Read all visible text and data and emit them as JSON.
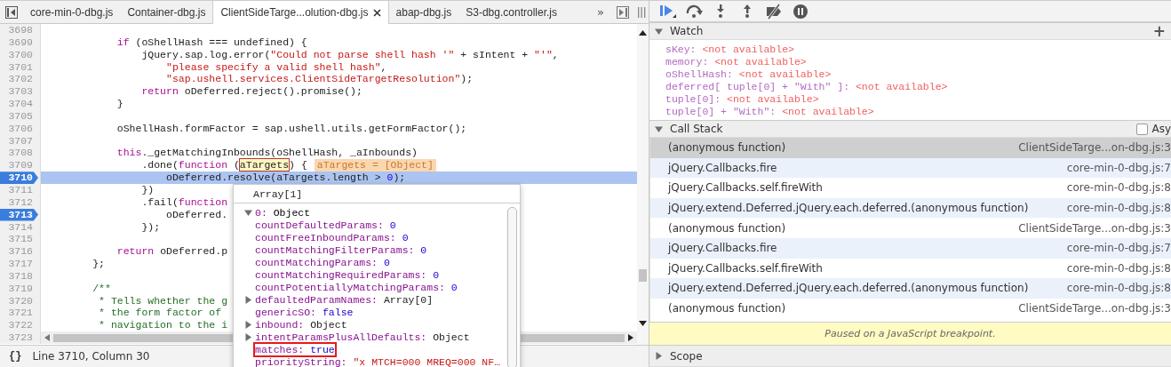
{
  "editor": {
    "tabs": [
      {
        "label": "core-min-0-dbg.js",
        "selected": false
      },
      {
        "label": "Container-dbg.js",
        "selected": false
      },
      {
        "label": "ClientSideTarge...olution-dbg.js",
        "selected": true
      },
      {
        "label": "abap-dbg.js",
        "selected": false
      },
      {
        "label": "S3-dbg.controller.js",
        "selected": false
      }
    ],
    "overflow": "»",
    "lines": [
      {
        "number": "3698",
        "breakpoint": false,
        "current": false
      },
      {
        "number": "3699",
        "breakpoint": false,
        "current": false,
        "tokens": [
          {
            "kind": "keyword",
            "text": "            if"
          },
          {
            "kind": "plain",
            "text": " (oShellHash === undefined) {"
          }
        ]
      },
      {
        "number": "3700",
        "breakpoint": false,
        "current": false,
        "tokens": [
          {
            "kind": "plain",
            "text": "                jQuery.sap.log.error("
          },
          {
            "kind": "string",
            "text": "\"Could not parse shell hash '\""
          },
          {
            "kind": "plain",
            "text": " + sIntent + "
          },
          {
            "kind": "string",
            "text": "\"'\""
          },
          {
            "kind": "plain",
            "text": ","
          }
        ]
      },
      {
        "number": "3701",
        "breakpoint": false,
        "current": false,
        "tokens": [
          {
            "kind": "string",
            "text": "                    \"please specify a valid shell hash\""
          },
          {
            "kind": "plain",
            "text": ","
          }
        ]
      },
      {
        "number": "3702",
        "breakpoint": false,
        "current": false,
        "tokens": [
          {
            "kind": "string",
            "text": "                    \"sap.ushell.services.ClientSideTargetResolution\""
          },
          {
            "kind": "plain",
            "text": ");"
          }
        ]
      },
      {
        "number": "3703",
        "breakpoint": false,
        "current": false,
        "tokens": [
          {
            "kind": "keyword",
            "text": "                return"
          },
          {
            "kind": "plain",
            "text": " oDeferred.reject().promise();"
          }
        ]
      },
      {
        "number": "3704",
        "breakpoint": false,
        "current": false,
        "tokens": [
          {
            "kind": "plain",
            "text": "            }"
          }
        ]
      },
      {
        "number": "3705",
        "breakpoint": false,
        "current": false
      },
      {
        "number": "3706",
        "breakpoint": false,
        "current": false,
        "tokens": [
          {
            "kind": "plain",
            "text": "            oShellHash.formFactor = sap.ushell.utils.getFormFactor();"
          }
        ]
      },
      {
        "number": "3707",
        "breakpoint": false,
        "current": false
      },
      {
        "number": "3708",
        "breakpoint": false,
        "current": false,
        "tokens": [
          {
            "kind": "keyword",
            "text": "            this"
          },
          {
            "kind": "plain",
            "text": "._getMatchingInbounds(oShellHash, _aInbounds)"
          }
        ]
      },
      {
        "number": "3709",
        "breakpoint": false,
        "current": false,
        "tokens": [
          {
            "kind": "plain",
            "text": "                .done("
          },
          {
            "kind": "keyword",
            "text": "function"
          },
          {
            "kind": "plain",
            "text": " ("
          },
          {
            "kind": "hover",
            "text": "aTargets"
          },
          {
            "kind": "plain",
            "text": ") {"
          }
        ],
        "inline_value": "aTargets = [Object]"
      },
      {
        "number": "3710",
        "breakpoint": true,
        "current": true,
        "tokens": [
          {
            "kind": "plain",
            "text": "                    oDeferred.resolve(aTargets.length > "
          },
          {
            "kind": "number",
            "text": "0"
          },
          {
            "kind": "plain",
            "text": ");"
          }
        ]
      },
      {
        "number": "3711",
        "breakpoint": false,
        "current": false,
        "tokens": [
          {
            "kind": "plain",
            "text": "                })"
          }
        ]
      },
      {
        "number": "3712",
        "breakpoint": false,
        "current": false,
        "tokens": [
          {
            "kind": "plain",
            "text": "                .fail("
          },
          {
            "kind": "keyword",
            "text": "function"
          }
        ]
      },
      {
        "number": "3713",
        "breakpoint": true,
        "current": false,
        "tokens": [
          {
            "kind": "plain",
            "text": "                    oDeferred."
          }
        ]
      },
      {
        "number": "3714",
        "breakpoint": false,
        "current": false,
        "tokens": [
          {
            "kind": "plain",
            "text": "                });"
          }
        ]
      },
      {
        "number": "3715",
        "breakpoint": false,
        "current": false
      },
      {
        "number": "3716",
        "breakpoint": false,
        "current": false,
        "tokens": [
          {
            "kind": "keyword",
            "text": "            return"
          },
          {
            "kind": "plain",
            "text": " oDeferred.p"
          }
        ]
      },
      {
        "number": "3717",
        "breakpoint": false,
        "current": false,
        "tokens": [
          {
            "kind": "plain",
            "text": "        };"
          }
        ]
      },
      {
        "number": "3718",
        "breakpoint": false,
        "current": false
      },
      {
        "number": "3719",
        "breakpoint": false,
        "current": false,
        "tokens": [
          {
            "kind": "comment",
            "text": "        /**"
          }
        ]
      },
      {
        "number": "3720",
        "breakpoint": false,
        "current": false,
        "tokens": [
          {
            "kind": "comment",
            "text": "         * Tells whether the g"
          }
        ]
      },
      {
        "number": "3721",
        "breakpoint": false,
        "current": false,
        "tokens": [
          {
            "kind": "comment",
            "text": "         * the form factor of"
          }
        ]
      },
      {
        "number": "3722",
        "breakpoint": false,
        "current": false,
        "tokens": [
          {
            "kind": "comment",
            "text": "         * navigation to the i"
          }
        ]
      },
      {
        "number": "3723",
        "breakpoint": false,
        "current": false
      }
    ],
    "popover": {
      "title": "Array[1]",
      "root": {
        "name": "0:",
        "value": "Object",
        "expanded": true,
        "children": [
          {
            "name": "countDefaultedParams:",
            "value": "0",
            "kind": "number",
            "highlighted": false
          },
          {
            "name": "countFreeInboundParams:",
            "value": "0",
            "kind": "number",
            "highlighted": false
          },
          {
            "name": "countMatchingFilterParams:",
            "value": "0",
            "kind": "number",
            "highlighted": false
          },
          {
            "name": "countMatchingParams:",
            "value": "0",
            "kind": "number",
            "highlighted": false
          },
          {
            "name": "countMatchingRequiredParams:",
            "value": "0",
            "kind": "number",
            "highlighted": false
          },
          {
            "name": "countPotentiallyMatchingParams:",
            "value": "0",
            "kind": "number",
            "highlighted": false
          },
          {
            "name": "defaultedParamNames:",
            "value": "Array[0]",
            "kind": "object",
            "expanded": false,
            "highlighted": false
          },
          {
            "name": "genericSO:",
            "value": "false",
            "kind": "boolean",
            "highlighted": false
          },
          {
            "name": "inbound:",
            "value": "Object",
            "kind": "object",
            "expanded": false,
            "highlighted": false
          },
          {
            "name": "intentParamsPlusAllDefaults:",
            "value": "Object",
            "kind": "object",
            "expanded": false,
            "highlighted": false
          },
          {
            "name": "matches:",
            "value": "true",
            "kind": "boolean",
            "highlighted": true
          },
          {
            "name": "priorityString:",
            "value": "\"x MTCH=000 MREQ=000 NF…",
            "kind": "string",
            "highlighted": false
          }
        ]
      }
    },
    "status": {
      "format_button": "{}",
      "position": "Line 3710, Column 30"
    }
  },
  "debugger": {
    "toolbar": [
      {
        "kind": "resume"
      },
      {
        "kind": "step_over"
      },
      {
        "kind": "step_into"
      },
      {
        "kind": "step_out"
      },
      {
        "kind": "deactivate"
      },
      {
        "kind": "pause"
      }
    ],
    "watch": {
      "title": "Watch",
      "expanded": true,
      "add": "+",
      "items": [
        {
          "expression": "sKey:",
          "value": "<not available>"
        },
        {
          "expression": "memory:",
          "value": "<not available>"
        },
        {
          "expression": "oShellHash:",
          "value": "<not available>"
        },
        {
          "expression": "deferred[ tuple[0] + \"With\" ]:",
          "value": "<not available>"
        },
        {
          "expression": "tuple[0]:",
          "value": "<not available>"
        },
        {
          "expression": "tuple[0] + \"With\":",
          "value": "<not available>"
        }
      ]
    },
    "call_stack": {
      "title": "Call Stack",
      "expanded": true,
      "async": {
        "label": "Asy",
        "checked": false
      },
      "frames": [
        {
          "name": "(anonymous function)",
          "location": "ClientSideTarge...on-dbg.js:3",
          "selected": true
        },
        {
          "name": "jQuery.Callbacks.fire",
          "location": "core-min-0-dbg.js:7",
          "selected": false
        },
        {
          "name": "jQuery.Callbacks.self.fireWith",
          "location": "core-min-0-dbg.js:8",
          "selected": false
        },
        {
          "name": "jQuery.extend.Deferred.jQuery.each.deferred.(anonymous function)",
          "location": "core-min-0-dbg.js:8",
          "selected": false
        },
        {
          "name": "(anonymous function)",
          "location": "ClientSideTarge...on-dbg.js:3",
          "selected": false
        },
        {
          "name": "jQuery.Callbacks.fire",
          "location": "core-min-0-dbg.js:7",
          "selected": false
        },
        {
          "name": "jQuery.Callbacks.self.fireWith",
          "location": "core-min-0-dbg.js:8",
          "selected": false
        },
        {
          "name": "jQuery.extend.Deferred.jQuery.each.deferred.(anonymous function)",
          "location": "core-min-0-dbg.js:8",
          "selected": false
        },
        {
          "name": "(anonymous function)",
          "location": "ClientSideTarge...on-dbg.js:3",
          "selected": false
        }
      ],
      "notice": "Paused on a JavaScript breakpoint."
    },
    "scope": {
      "title": "Scope",
      "expanded": false
    }
  }
}
